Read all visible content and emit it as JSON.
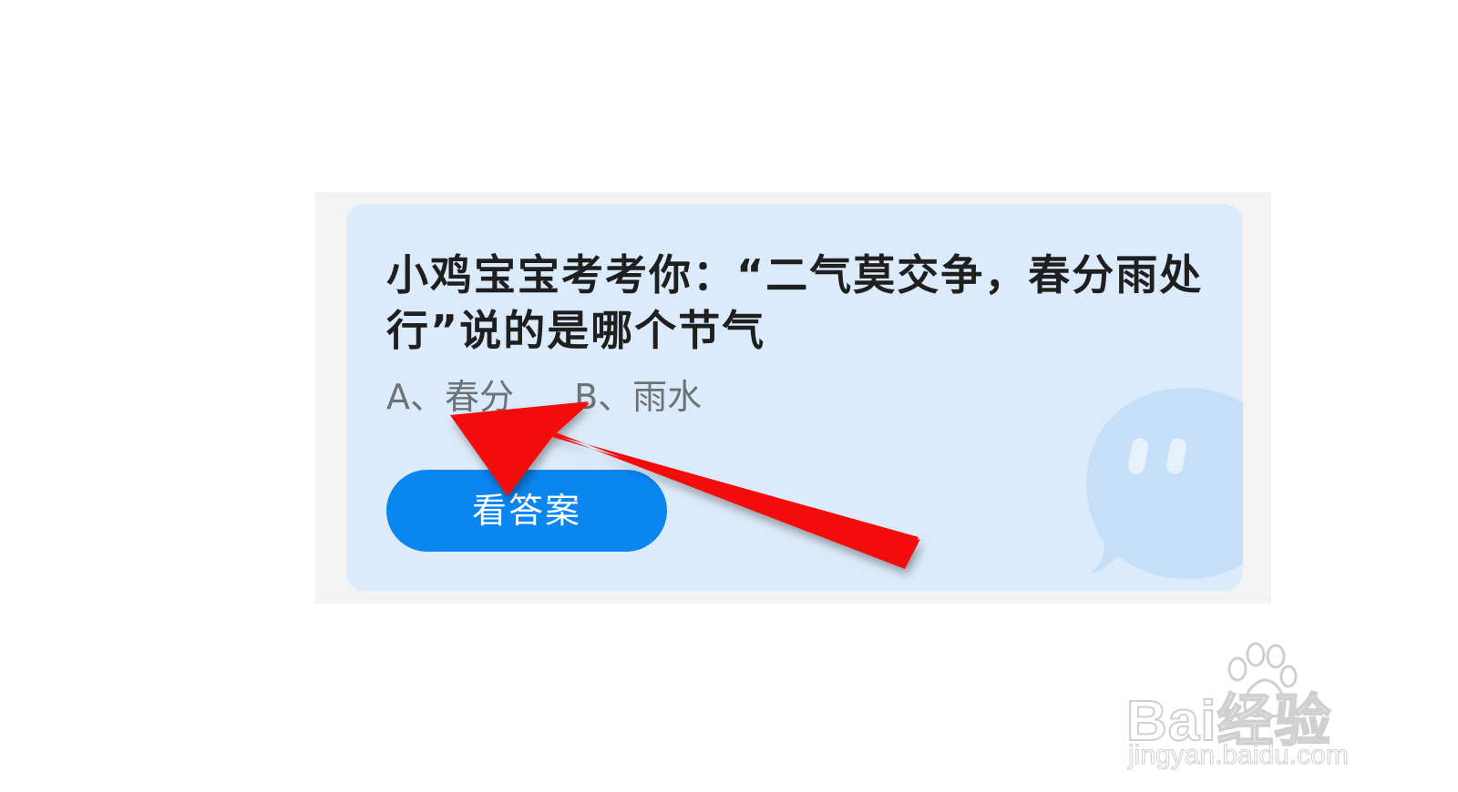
{
  "quiz": {
    "question": "小鸡宝宝考考你：“二气莫交争，春分雨处行”说的是哪个节气",
    "options": [
      "A、春分",
      "B、雨水"
    ],
    "answer_button_label": "看答案"
  },
  "watermark": {
    "logo_text": "Bai经验",
    "url": "jingyan.baidu.com"
  },
  "colors": {
    "card_background": "#dcebfb",
    "button_blue": "#0a86f1",
    "annotation_arrow": "#f40c0c"
  },
  "icons": {
    "mascot": "chat-bubble-mascot-icon",
    "annotation": "red-arrow-icon",
    "watermark": "baidu-paw-icon"
  }
}
